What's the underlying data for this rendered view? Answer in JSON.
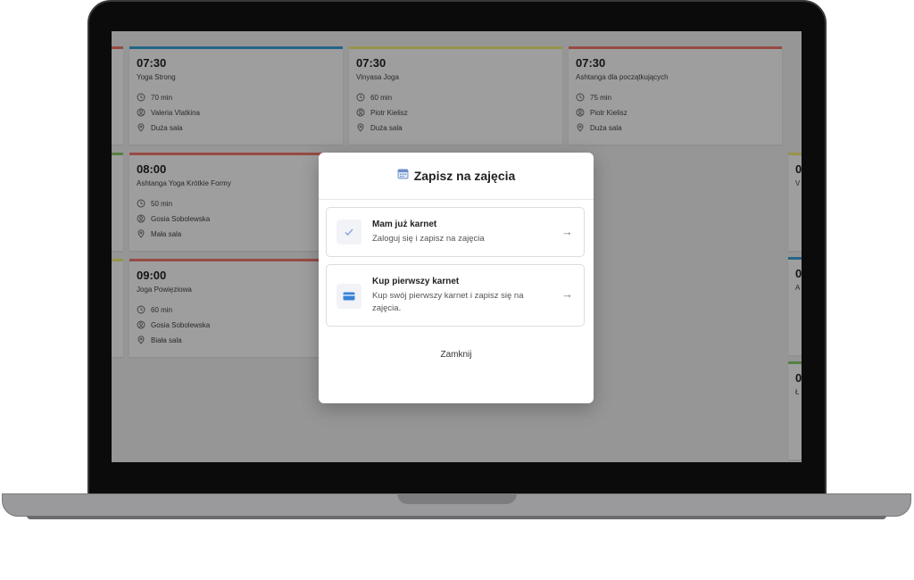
{
  "schedule": {
    "cards": [
      {
        "time": "07:30",
        "name": "Yoga Strong",
        "duration": "70 min",
        "teacher": "Valeria Vlatkina",
        "room": "Duża sala",
        "accent": "#3ba4d9"
      },
      {
        "time": "07:30",
        "name": "Vinyasa Joga",
        "duration": "60 min",
        "teacher": "Piotr Kielisz",
        "room": "Duża sala",
        "accent": "#f3ef7a"
      },
      {
        "time": "07:30",
        "name": "Ashtanga dla początkujących",
        "duration": "75 min",
        "teacher": "Piotr Kielisz",
        "room": "Duża sala",
        "accent": "#f47a6e"
      },
      {
        "time": "08:00",
        "name": "Ashtanga Yoga Krótkie Formy",
        "duration": "50 min",
        "teacher": "Gosia Sobolewska",
        "room": "Mała sala",
        "accent": "#f47a6e"
      },
      {
        "time": "09:00",
        "name": "Joga Powięziowa",
        "duration": "60 min",
        "teacher": "Gosia Sobolewska",
        "room": "Biała sala",
        "accent": "#f47a6e"
      }
    ],
    "edge_cards": [
      {
        "time": "0",
        "name": "V",
        "accent": "#f3ef7a"
      },
      {
        "time": "0",
        "name": "A",
        "accent": "#3ba4d9"
      },
      {
        "time": "0",
        "name": "Ł",
        "accent": "#8ccf6a"
      }
    ]
  },
  "modal": {
    "title": "Zapisz na zajęcia",
    "title_icon": "calendar-icon",
    "options": [
      {
        "title": "Mam już karnet",
        "desc": "Zaloguj się i zapisz na zajęcia",
        "icon": "check-icon"
      },
      {
        "title": "Kup pierwszy karnet",
        "desc": "Kup swój pierwszy karnet i zapisz się na zajęcia.",
        "icon": "credit-card-icon"
      }
    ],
    "arrow": "→",
    "close_label": "Zamknij"
  }
}
